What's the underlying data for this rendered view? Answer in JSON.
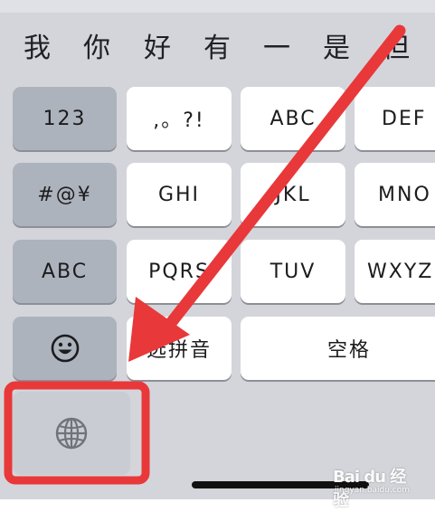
{
  "candidates": [
    "我",
    "你",
    "好",
    "有",
    "一",
    "是",
    "但"
  ],
  "left_column": {
    "num_key": "123",
    "symbol_key": "#@¥",
    "abc_key": "ABC",
    "emoji_icon": "smiley-icon",
    "globe_icon": "globe-icon"
  },
  "keys": {
    "punct": ",。?!",
    "abc": "ABC",
    "def": "DEF",
    "ghi": "GHI",
    "jkl": "JKL",
    "mno": "MNO",
    "pqrs": "PQRS",
    "tuv": "TUV",
    "wxyz": "WXYZ",
    "pinyin": "选拼音",
    "space": "空格"
  },
  "watermark": {
    "brand": "Bai du 经验",
    "url": "jingyan.baidu.com"
  },
  "annotation": {
    "arrow_color": "#e8383a",
    "highlight_color": "#e8383a"
  }
}
